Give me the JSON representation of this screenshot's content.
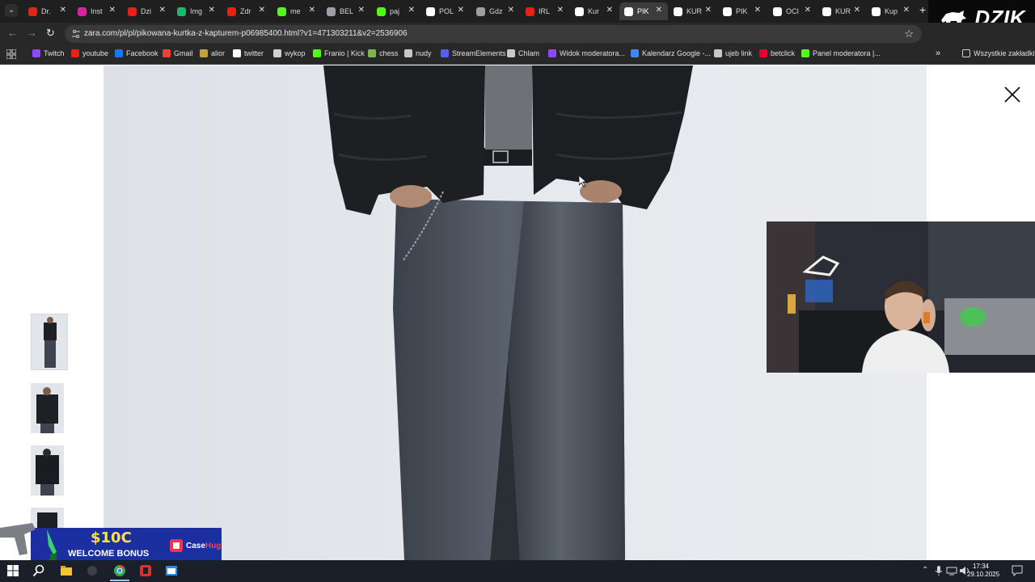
{
  "browser": {
    "tabs": [
      {
        "label": "Dr.",
        "favicon": "youtube-icon",
        "color": "#e62117"
      },
      {
        "label": "Inst",
        "favicon": "instagram-icon",
        "color": "#d6249f"
      },
      {
        "label": "Dzi",
        "favicon": "youtube-icon",
        "color": "#e62117"
      },
      {
        "label": "Img",
        "favicon": "imgur-icon",
        "color": "#1bb76e"
      },
      {
        "label": "Zdr",
        "favicon": "youtube-icon",
        "color": "#e62117"
      },
      {
        "label": "me",
        "favicon": "kick-icon",
        "color": "#53fc18"
      },
      {
        "label": "BEL",
        "favicon": "globe-icon",
        "color": "#9aa0a6"
      },
      {
        "label": "paj",
        "favicon": "kick-icon",
        "color": "#53fc18"
      },
      {
        "label": "POL",
        "favicon": "google-icon",
        "color": "#ffffff"
      },
      {
        "label": "Gdz",
        "favicon": "globe-icon",
        "color": "#9aa0a6"
      },
      {
        "label": "IRL",
        "favicon": "youtube-icon",
        "color": "#e62117"
      },
      {
        "label": "Kur",
        "favicon": "zara-icon",
        "color": "#ffffff"
      },
      {
        "label": "PIK",
        "favicon": "zara-icon",
        "color": "#ffffff"
      },
      {
        "label": "KUR",
        "favicon": "zara-icon",
        "color": "#ffffff"
      },
      {
        "label": "PIK",
        "favicon": "zara-icon",
        "color": "#ffffff"
      },
      {
        "label": "OCI",
        "favicon": "zara-icon",
        "color": "#ffffff"
      },
      {
        "label": "KUR",
        "favicon": "zara-icon",
        "color": "#ffffff"
      },
      {
        "label": "Kup",
        "favicon": "store-icon",
        "color": "#ffffff"
      }
    ],
    "active_tab_index": 12,
    "url": "zara.com/pl/pl/pikowana-kurtka-z-kapturem-p06985400.html?v1=471303211&v2=2536906",
    "overlay_logo": "DZIK",
    "bookmarks": [
      {
        "label": "Twitch",
        "icon": "twitch-icon",
        "color": "#9146ff"
      },
      {
        "label": "youtube",
        "icon": "youtube-icon",
        "color": "#e62117"
      },
      {
        "label": "Facebook",
        "icon": "facebook-icon",
        "color": "#1877f2"
      },
      {
        "label": "Gmail",
        "icon": "gmail-icon",
        "color": "#ea4335"
      },
      {
        "label": "alior",
        "icon": "alior-icon",
        "color": "#c7a23c"
      },
      {
        "label": "twitter",
        "icon": "x-icon",
        "color": "#ffffff"
      },
      {
        "label": "wykop",
        "icon": "wykop-icon",
        "color": "#d0d0d0"
      },
      {
        "label": "Franio | Kick",
        "icon": "kick-icon",
        "color": "#53fc18"
      },
      {
        "label": "chess",
        "icon": "chess-icon",
        "color": "#81b64c"
      },
      {
        "label": "nudy",
        "icon": "folder-icon",
        "color": "#c8c8c8"
      },
      {
        "label": "StreamElements",
        "icon": "streamelements-icon",
        "color": "#5b5bf5"
      },
      {
        "label": "Chlam",
        "icon": "globe-icon",
        "color": "#c8c8c8"
      },
      {
        "label": "Widok moderatora...",
        "icon": "twitch-icon",
        "color": "#9146ff"
      },
      {
        "label": "Kalendarz Google -...",
        "icon": "calendar-icon",
        "color": "#4285f4"
      },
      {
        "label": "ujeb link",
        "icon": "globe-icon",
        "color": "#c8c8c8"
      },
      {
        "label": "betclick",
        "icon": "betclick-icon",
        "color": "#e4002b"
      },
      {
        "label": "Panel moderatora |...",
        "icon": "kick-icon",
        "color": "#53fc18"
      }
    ],
    "all_bookmarks": "Wszystkie zakładki"
  },
  "promo": {
    "amount": "$10C",
    "text": "WELCOME BONUS",
    "brand_a": "Case",
    "brand_b": "Hug"
  },
  "taskbar": {
    "time": "17:34",
    "date": "29.10.2025"
  },
  "colors": {
    "tab_bar": "#1f1f1f",
    "toolbar": "#282828",
    "photo_bg": "#e4e7eb",
    "promo_bg": "#1c2fa0",
    "promo_gold": "#ffe24a"
  }
}
